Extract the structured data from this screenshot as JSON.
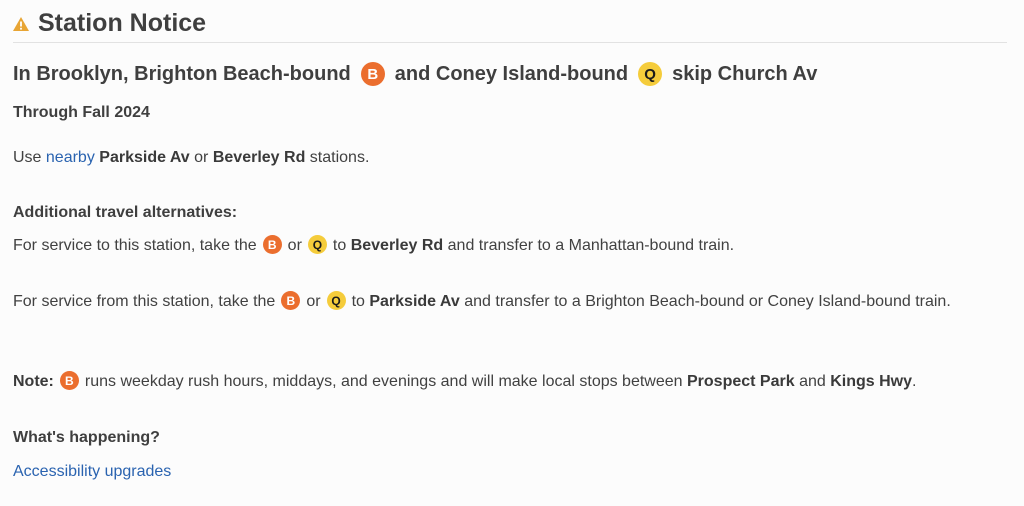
{
  "header": {
    "icon": "warning-triangle-icon",
    "title": "Station Notice",
    "icon_color": "#e8a534"
  },
  "notice": {
    "headline": {
      "part1": "In Brooklyn, Brighton Beach-bound",
      "bullet1": "B",
      "part2": "and Coney Island-bound",
      "bullet2": "Q",
      "part3": "skip Church Av"
    },
    "duration": "Through Fall 2024",
    "use_line": {
      "prefix": "Use",
      "link": "nearby",
      "station1": "Parkside Av",
      "joiner": "or",
      "station2": "Beverley Rd",
      "suffix": "stations."
    },
    "alternatives_title": "Additional travel alternatives:",
    "to_station": {
      "prefix": "For service to this station, take the",
      "bullet1": "B",
      "joiner": "or",
      "bullet2": "Q",
      "to": "to",
      "station": "Beverley Rd",
      "suffix": "and transfer to a Manhattan-bound train."
    },
    "from_station": {
      "prefix": "For service from this station, take the",
      "bullet1": "B",
      "joiner": "or",
      "bullet2": "Q",
      "to": "to",
      "station": "Parkside Av",
      "suffix": "and transfer to a Brighton Beach-bound or Coney Island-bound train."
    },
    "note": {
      "label": "Note:",
      "bullet": "B",
      "text1": "runs weekday rush hours, middays, and evenings and will make local stops between",
      "station1": "Prospect Park",
      "joiner": "and",
      "station2": "Kings Hwy",
      "end": "."
    },
    "whats_happening_title": "What's happening?",
    "whats_happening_link": "Accessibility upgrades"
  },
  "colors": {
    "b_train": "#eb6e2e",
    "q_train": "#f5cc3b",
    "link": "#2a63b0",
    "text": "#414141"
  }
}
